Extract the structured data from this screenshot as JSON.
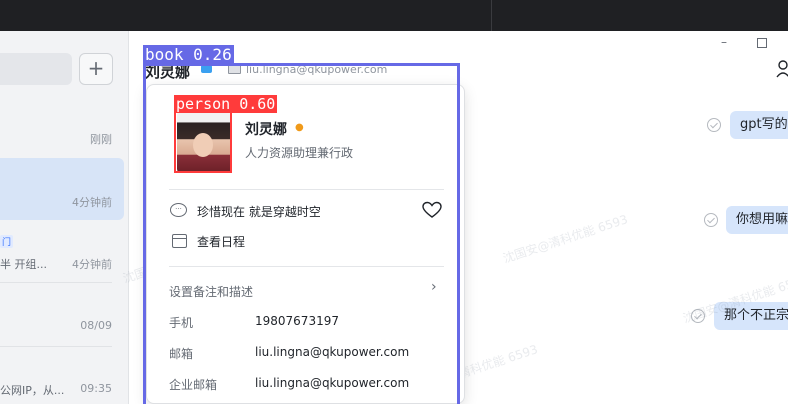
{
  "sidebar": {
    "add_label": "+",
    "items": [
      {
        "time": "刚刚"
      },
      {
        "time": "4分钟前"
      },
      {
        "tag": "门",
        "preview": "半 开组...",
        "time": "4分钟前"
      },
      {
        "time": "08/09"
      },
      {
        "preview": "公网IP，从...",
        "time": "09:35"
      }
    ]
  },
  "header": {
    "name": "刘灵娜",
    "email": "liu.lingna@qkupower.com",
    "minimize": "–"
  },
  "messages": [
    {
      "text": "gpt写的"
    },
    {
      "text": "你想用嘛"
    },
    {
      "text": "那个不正宗"
    }
  ],
  "watermark_text": "沈国安@清科优能 6593",
  "card": {
    "name": "刘灵娜",
    "title": "人力资源助理兼行政",
    "signature_label": "珍惜现在",
    "signature_text": "就是穿越时空",
    "schedule_label": "查看日程",
    "remark_label": "设置备注和描述",
    "chevron": "›",
    "phone_label": "手机",
    "phone_value": "19807673197",
    "email_label": "邮箱",
    "email_value": "liu.lingna@qkupower.com",
    "corp_email_label": "企业邮箱",
    "corp_email_value": "liu.lingna@qkupower.com"
  },
  "detections": {
    "person_label": "person 0.60",
    "book_label": "book 0.26",
    "person_color": "#ff3b3b",
    "book_color": "#6669e6"
  },
  "colors": {
    "accent": "#3370ff",
    "bubble": "#d6e5fb",
    "topbar": "#1f2023"
  }
}
